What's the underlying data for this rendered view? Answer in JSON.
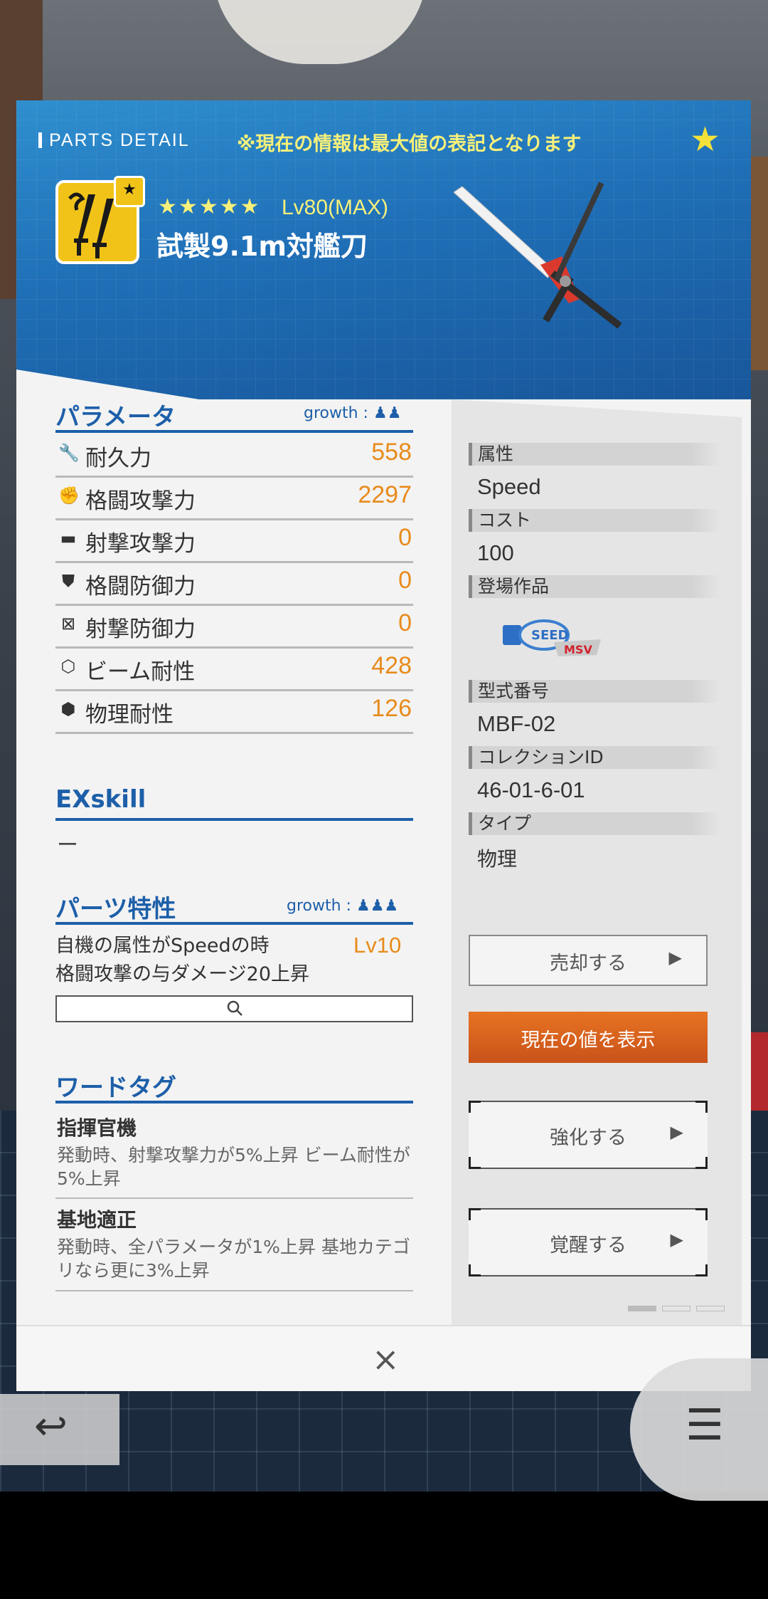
{
  "header": {
    "section_label": "PARTS DETAIL",
    "notice": "※現在の情報は最大値の表記となります",
    "favorite_icon": "star-icon",
    "rarity_stars": "★★★★★",
    "level": "Lv80(MAX)",
    "part_name": "試製9.1m対艦刀"
  },
  "params": {
    "title": "パラメータ",
    "growth": "growth :",
    "rows": [
      {
        "icon": "wrench-icon",
        "label": "耐久力",
        "value": "558"
      },
      {
        "icon": "melee-attack-icon",
        "label": "格闘攻撃力",
        "value": "2297"
      },
      {
        "icon": "gun-icon",
        "label": "射撃攻撃力",
        "value": "0"
      },
      {
        "icon": "melee-defense-icon",
        "label": "格闘防御力",
        "value": "0"
      },
      {
        "icon": "ranged-defense-icon",
        "label": "射撃防御力",
        "value": "0"
      },
      {
        "icon": "beam-resist-icon",
        "label": "ビーム耐性",
        "value": "428"
      },
      {
        "icon": "physical-resist-icon",
        "label": "物理耐性",
        "value": "126"
      }
    ]
  },
  "exskill": {
    "title": "EXskill",
    "value": "ー"
  },
  "traits": {
    "title": "パーツ特性",
    "growth": "growth :",
    "line1": "自機の属性がSpeedの時",
    "line2": "格闘攻撃の与ダメージ20上昇",
    "level": "Lv10"
  },
  "word_tags": {
    "title": "ワードタグ",
    "items": [
      {
        "name": "指揮官機",
        "desc": "発動時、射撃攻撃力が5%上昇 ビーム耐性が5%上昇"
      },
      {
        "name": "基地適正",
        "desc": "発動時、全パラメータが1%上昇 基地カテゴリなら更に3%上昇"
      }
    ]
  },
  "info": {
    "attribute_label": "属性",
    "attribute_value": "Speed",
    "cost_label": "コスト",
    "cost_value": "100",
    "series_label": "登場作品",
    "model_label": "型式番号",
    "model_value": "MBF-02",
    "collection_label": "コレクションID",
    "collection_value": "46-01-6-01",
    "type_label": "タイプ",
    "type_value": "物理"
  },
  "buttons": {
    "sell": "売却する",
    "show_current": "現在の値を表示",
    "enhance": "強化する",
    "awaken": "覚醒する",
    "close": "×",
    "back": "↩",
    "menu": "☰"
  },
  "colors": {
    "header_blue": "#1f6fb7",
    "section_blue": "#1d5fa9",
    "value_orange": "#e88b1b",
    "accent_orange": "#d8621e",
    "notice_yellow": "#f6f07a"
  }
}
